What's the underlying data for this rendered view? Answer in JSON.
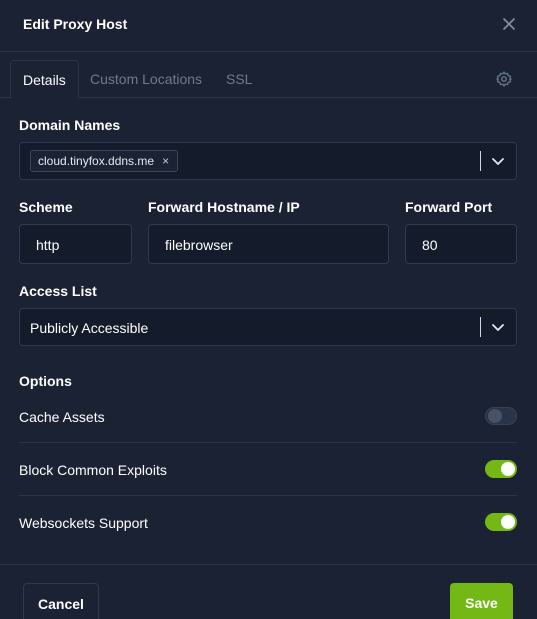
{
  "modal": {
    "title": "Edit Proxy Host",
    "close_icon": "close-icon"
  },
  "tabs": [
    {
      "label": "Details",
      "active": true
    },
    {
      "label": "Custom Locations",
      "active": false
    },
    {
      "label": "SSL",
      "active": false
    }
  ],
  "settings_icon": "gear-icon",
  "domain_names": {
    "label": "Domain Names",
    "chips": [
      {
        "value": "cloud.tinyfox.ddns.me",
        "remove_glyph": "×"
      }
    ]
  },
  "scheme": {
    "label": "Scheme",
    "value": "http"
  },
  "forward_host": {
    "label": "Forward Hostname / IP",
    "value": "filebrowser"
  },
  "forward_port": {
    "label": "Forward Port",
    "value": "80"
  },
  "access_list": {
    "label": "Access List",
    "value": "Publicly Accessible"
  },
  "options": {
    "heading": "Options",
    "items": [
      {
        "label": "Cache Assets",
        "enabled": false
      },
      {
        "label": "Block Common Exploits",
        "enabled": true
      },
      {
        "label": "Websockets Support",
        "enabled": true
      }
    ]
  },
  "footer": {
    "cancel_label": "Cancel",
    "save_label": "Save"
  },
  "colors": {
    "background": "#1a2234",
    "input_background": "#141b2a",
    "accent_green": "#74b816",
    "muted_text": "#6e7a8f"
  }
}
